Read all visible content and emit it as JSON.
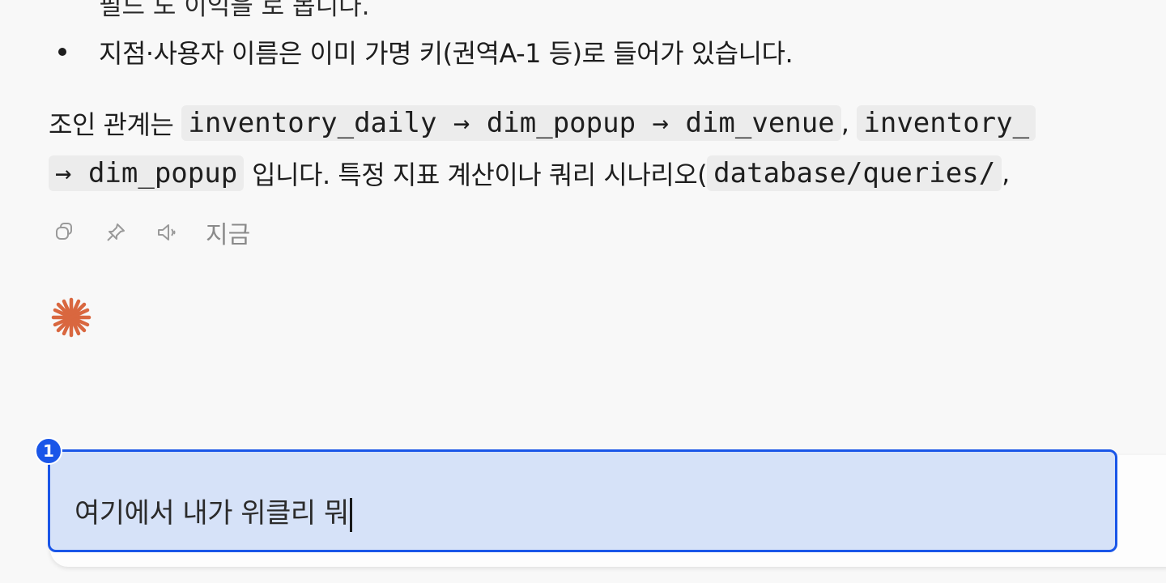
{
  "message": {
    "clipped_line": "필드 도 이익을 로 봅니다.",
    "bullet_text": "지점·사용자 이름은 이미 가명 키(권역A-1 등)로 들어가 있습니다.",
    "join_para": {
      "prefix": "조인 관계는",
      "code_chain": "inventory_daily → dim_popup → dim_venue",
      "sep": ",",
      "code_second": "inventory_",
      "line2_code": "→ dim_popup",
      "line2_text": "입니다. 특정 지표 계산이나 쿼리 시나리오(",
      "line2_code2": "database/queries/",
      "line2_tail": ","
    },
    "meta": {
      "copy_icon": "copy-icon",
      "pin_icon": "pin-icon",
      "speaker_icon": "speaker-icon",
      "time": "지금"
    },
    "spark_icon": "spark-icon"
  },
  "composer": {
    "value": "여기에서 내가 위클리 뭐",
    "badge_number": "1",
    "highlight_color": "#1a56e8",
    "fill_color": "#d6e2f8"
  },
  "colors": {
    "spark": "#d9673f",
    "code_bg": "#ececec"
  }
}
